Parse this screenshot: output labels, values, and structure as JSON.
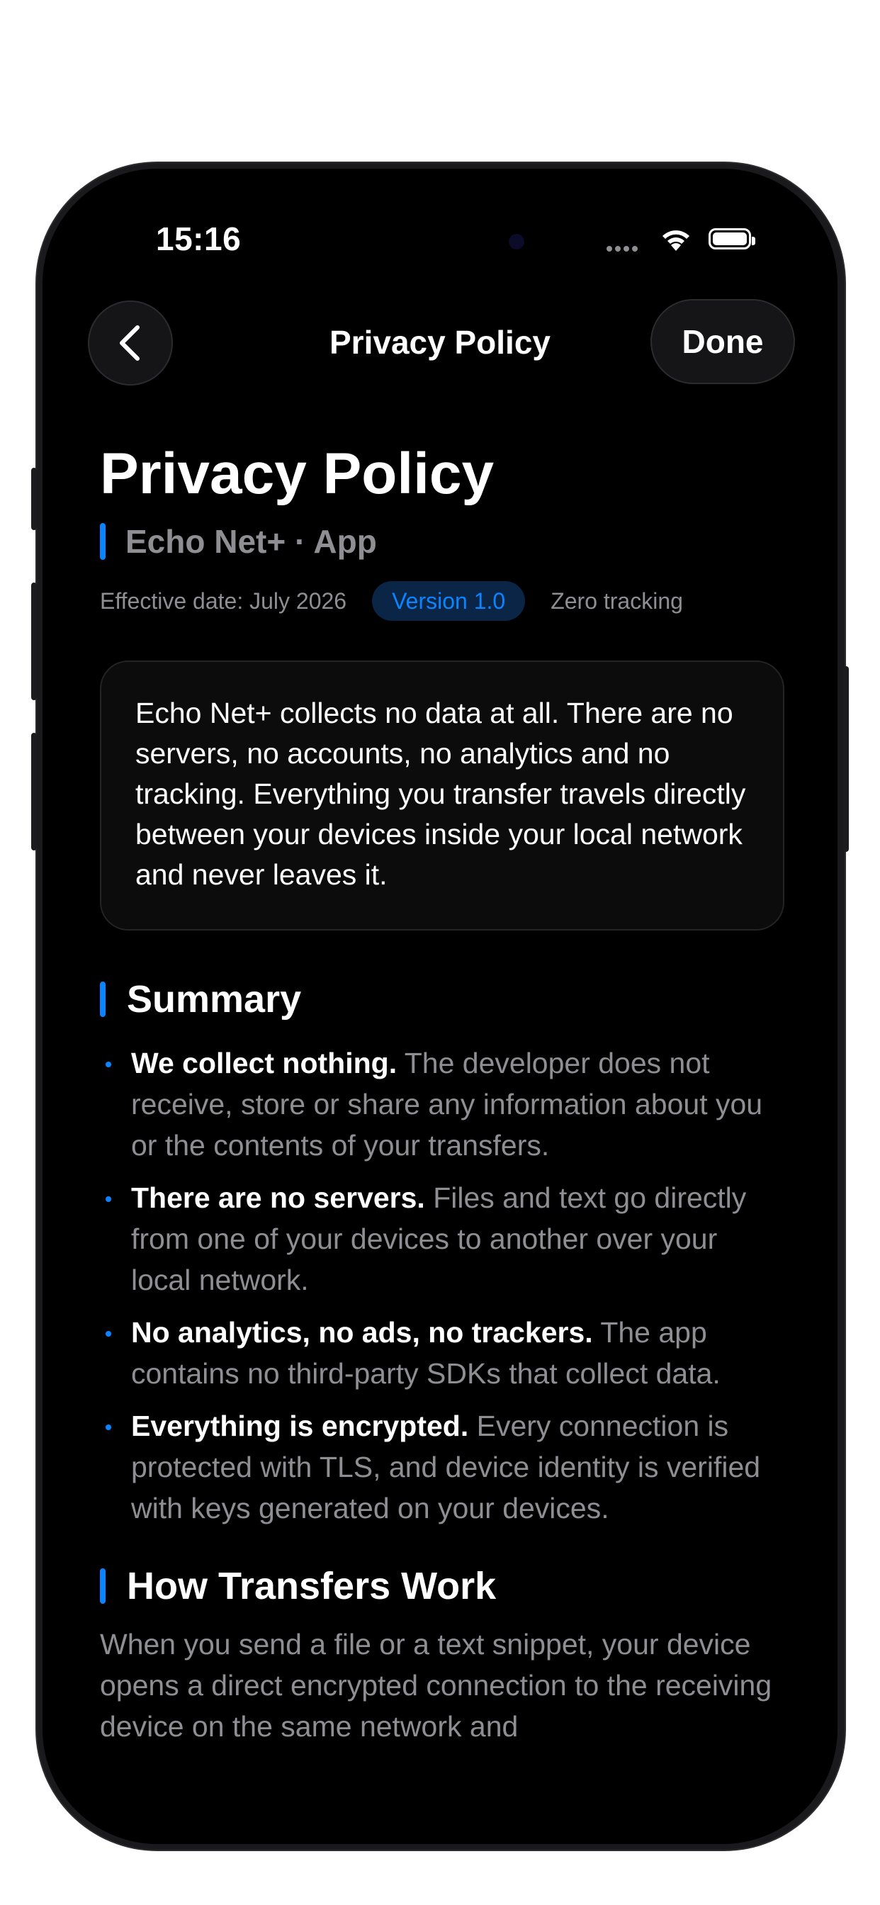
{
  "status_bar": {
    "time": "15:16"
  },
  "nav": {
    "title": "Privacy Policy",
    "done_label": "Done",
    "back_icon": "chevron-left-icon"
  },
  "header": {
    "title": "Privacy Policy",
    "subtitle": "Echo Net+ · App",
    "effective_date": "Effective date: July 2026",
    "version_badge": "Version 1.0",
    "tracking_note": "Zero tracking"
  },
  "intro": "Echo Net+ collects no data at all. There are no servers, no accounts, no analytics and no tracking. Everything you transfer travels directly between your devices inside your local network and never leaves it.",
  "summary": {
    "title": "Summary",
    "items": [
      {
        "bold": "We collect nothing.",
        "text": " The developer does not receive, store or share any information about you or the contents of your transfers."
      },
      {
        "bold": "There are no servers.",
        "text": " Files and text go directly from one of your devices to another over your local network."
      },
      {
        "bold": "No analytics, no ads, no trackers.",
        "text": " The app contains no third-party SDKs that collect data."
      },
      {
        "bold": "Everything is encrypted.",
        "text": " Every connection is protected with TLS, and device identity is verified with keys generated on your devices."
      }
    ]
  },
  "transfers": {
    "title": "How Transfers Work",
    "text": "When you send a file or a text snippet, your device opens a direct encrypted connection to the receiving device on the same network and"
  },
  "colors": {
    "accent": "#0a84ff",
    "background": "#000000",
    "secondary_text": "#8e8e93"
  }
}
